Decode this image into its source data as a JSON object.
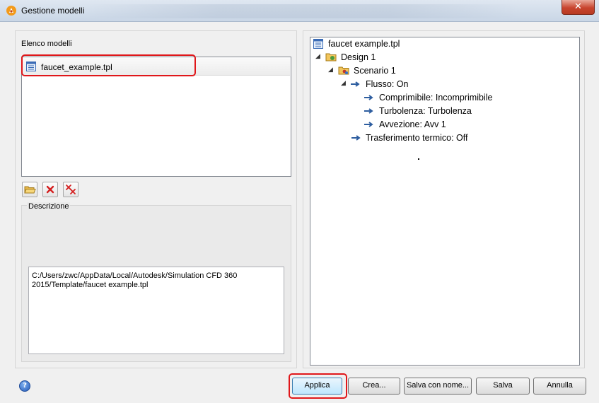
{
  "window": {
    "title": "Gestione modelli",
    "close_glyph": "✕",
    "app_icon": "autodesk-cfd-icon"
  },
  "left": {
    "list_label": "Elenco modelli",
    "models": [
      {
        "name": "faucet_example.tpl",
        "icon": "template-file-icon"
      }
    ],
    "toolbar_icons": [
      "open-folder-icon",
      "delete-icon",
      "delete-all-icon"
    ],
    "description_label": "Descrizione",
    "description_text": "C:/Users/zwc/AppData/Local/Autodesk/Simulation CFD 360 2015/Template/faucet example.tpl"
  },
  "tree": {
    "root": "faucet example.tpl",
    "design": "Design 1",
    "scenario": "Scenario 1",
    "flow": "Flusso: On",
    "compressible": "Comprimibile: Incomprimibile",
    "turbulence": "Turbolenza: Turbolenza",
    "advection": "Avvezione: Avv 1",
    "heat_transfer": "Trasferimento termico: Off"
  },
  "buttons": {
    "apply": "Applica",
    "create": "Crea...",
    "save_as": "Salva con nome...",
    "save": "Salva",
    "cancel": "Annulla",
    "help_glyph": "?"
  },
  "colors": {
    "highlight": "#e0171a",
    "selection_accent": "#3c7fb1"
  }
}
